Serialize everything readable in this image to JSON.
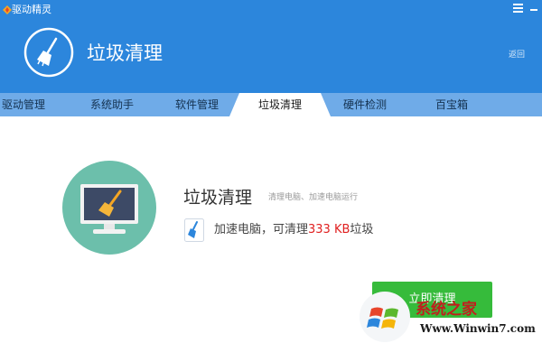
{
  "app": {
    "name": "驱动精灵"
  },
  "header": {
    "title": "垃圾清理",
    "back_label": "返回"
  },
  "tabs": [
    {
      "label": "驱动管理",
      "active": false
    },
    {
      "label": "系统助手",
      "active": false
    },
    {
      "label": "软件管理",
      "active": false
    },
    {
      "label": "垃圾清理",
      "active": true
    },
    {
      "label": "硬件检测",
      "active": false
    },
    {
      "label": "百宝箱",
      "active": false
    }
  ],
  "main": {
    "title": "垃圾清理",
    "subtitle": "清理电脑、加速电脑运行",
    "info_prefix": "加速电脑，可清理",
    "junk_size": "333 KB",
    "info_suffix": "垃圾",
    "clean_button": "立即清理"
  },
  "watermark": {
    "brand": "系统之家",
    "url": "Www.Winwin7.com"
  },
  "colors": {
    "header_blue": "#2c86dc",
    "tab_blue": "#6fabe8",
    "button_green": "#36bb3b",
    "highlight_red": "#e02020",
    "circle_teal": "#6cbfab"
  }
}
